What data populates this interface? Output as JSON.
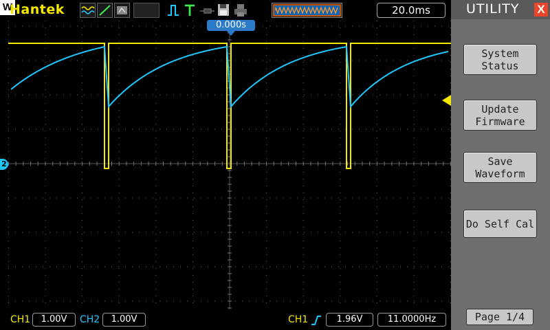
{
  "header": {
    "brand": "Hantek",
    "w_badge": "W",
    "timebase": "20.0ms"
  },
  "screen": {
    "trigger_position": "0.000s",
    "ch2_marker": "2",
    "colors": {
      "ch1": "#f5e800",
      "ch2": "#1ec8ff",
      "grid": "#6a6a6a",
      "accent": "#2b7bc8"
    }
  },
  "status": {
    "ch1_label": "CH1",
    "ch1_volts": "1.00V",
    "ch2_label": "CH2",
    "ch2_volts": "1.00V",
    "trigger_source": "CH1",
    "trigger_level": "1.96V",
    "trigger_frequency": "11.0000Hz"
  },
  "menu": {
    "title": "UTILITY",
    "close_label": "X",
    "items": [
      {
        "line1": "System",
        "line2": "Status"
      },
      {
        "line1": "Update",
        "line2": "Firmware"
      },
      {
        "line1": "Save",
        "line2": "Waveform"
      },
      {
        "line1": "Do Self Cal",
        "line2": ""
      }
    ],
    "page": "Page 1/4"
  },
  "icons": [
    "wave-mode-icon",
    "line-mode-icon",
    "display-mode-icon",
    "run-state-icon",
    "trigger-pulse-icon",
    "trigger-t-icon",
    "probe-icon",
    "save-icon",
    "print-icon",
    "memory-depth-icon",
    "rising-edge-icon",
    "close-icon"
  ]
}
